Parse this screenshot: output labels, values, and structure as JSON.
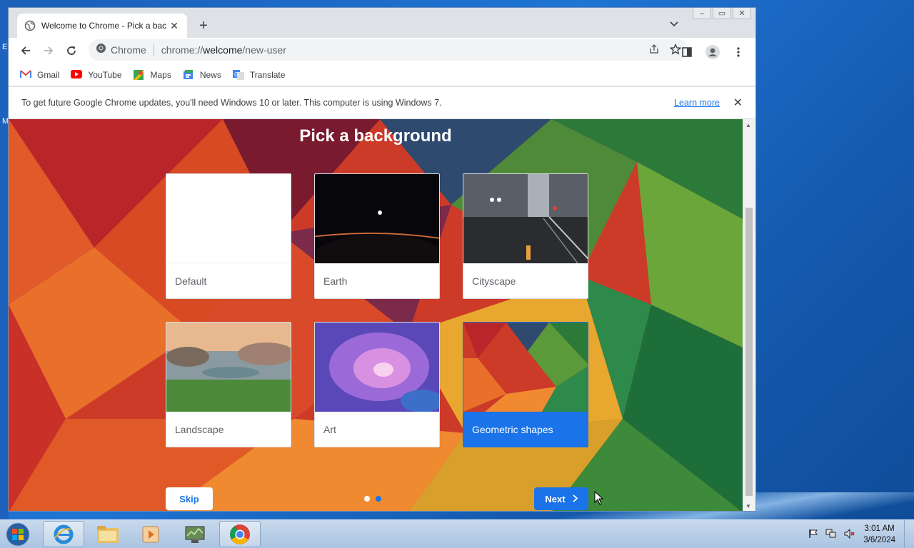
{
  "window": {
    "tab_title": "Welcome to Chrome - Pick a bac",
    "controls": {
      "minimize": "–",
      "restore": "▭",
      "close": "✕"
    }
  },
  "toolbar": {
    "omnibox_label": "Chrome",
    "url_scheme": "chrome://",
    "url_host": "welcome",
    "url_path": "/new-user"
  },
  "bookmarks": [
    {
      "label": "Gmail",
      "icon": "gmail-icon",
      "color": "#ea4335"
    },
    {
      "label": "YouTube",
      "icon": "youtube-icon",
      "color": "#ff0000"
    },
    {
      "label": "Maps",
      "icon": "maps-icon",
      "color": "#34a853"
    },
    {
      "label": "News",
      "icon": "news-icon",
      "color": "#4285f4"
    },
    {
      "label": "Translate",
      "icon": "translate-icon",
      "color": "#4285f4"
    }
  ],
  "infobar": {
    "message": "To get future Google Chrome updates, you'll need Windows 10 or later. This computer is using Windows 7.",
    "link": "Learn more",
    "close": "✕"
  },
  "main": {
    "title": "Pick a background",
    "options": [
      {
        "label": "Default",
        "selected": false
      },
      {
        "label": "Earth",
        "selected": false
      },
      {
        "label": "Cityscape",
        "selected": false
      },
      {
        "label": "Landscape",
        "selected": false
      },
      {
        "label": "Art",
        "selected": false
      },
      {
        "label": "Geometric shapes",
        "selected": true
      }
    ],
    "skip": "Skip",
    "next": "Next",
    "page_count": 2,
    "current_page": 2
  },
  "taskbar": {
    "items": [
      "start-orb",
      "internet-explorer",
      "file-explorer",
      "media-player",
      "system-monitor",
      "chrome"
    ],
    "active": "chrome",
    "time": "3:01 AM",
    "date": "3/6/2024"
  },
  "colors": {
    "accent": "#1a73e8",
    "desktop": "#1f74d4"
  }
}
